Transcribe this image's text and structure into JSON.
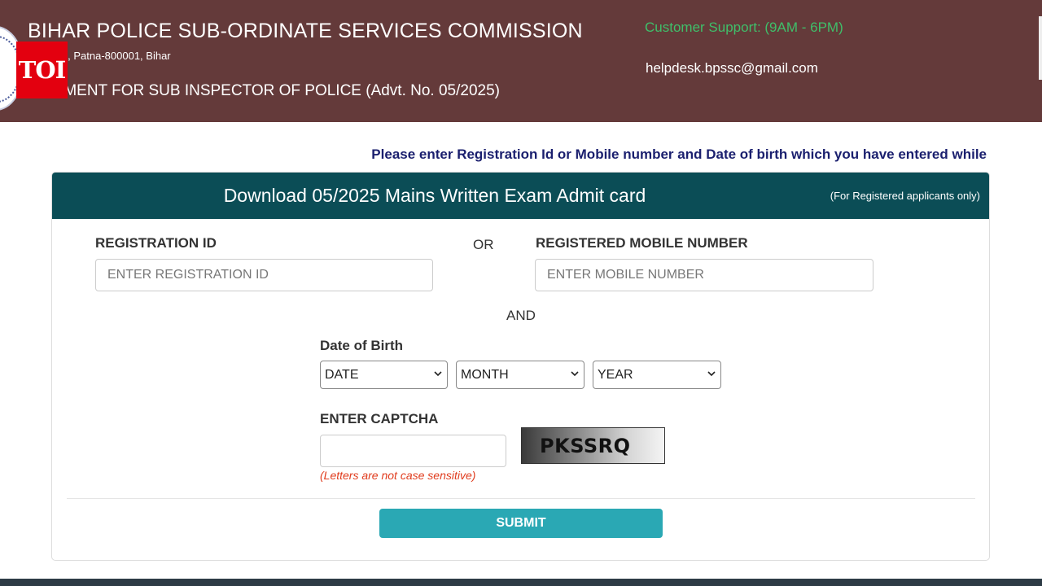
{
  "header": {
    "title": "BIHAR POLICE SUB-ORDINATE SERVICES COMMISSION",
    "address": "ng Road, Patna-800001, Bihar",
    "recruitment": "RUITMENT FOR SUB INSPECTOR OF POLICE (Advt. No. 05/2025)",
    "support": "Customer Support: (9AM - 6PM)",
    "email": "helpdesk.bpssc@gmail.com",
    "overlay_logo": "TOI"
  },
  "notice": "Please enter Registration Id or Mobile number and Date of birth which you have entered while",
  "card": {
    "title": "Download 05/2025 Mains Written Exam Admit card",
    "subtitle": "(For Registered applicants only)"
  },
  "form": {
    "registration_label": "REGISTRATION ID",
    "registration_placeholder": "ENTER REGISTRATION ID",
    "or_text": "OR",
    "mobile_label": "REGISTERED MOBILE NUMBER",
    "mobile_placeholder": "ENTER MOBILE NUMBER",
    "and_text": "AND",
    "dob_label": "Date of Birth",
    "date_select": "DATE",
    "month_select": "MONTH",
    "year_select": "YEAR",
    "captcha_label": "ENTER CAPTCHA",
    "captcha_value": "",
    "captcha_image_text": "PKSSRQ",
    "captcha_hint": "(Letters are not case sensitive)",
    "submit_label": "SUBMIT"
  },
  "colors": {
    "header_bg": "#643a3a",
    "card_header_bg": "#0b4d56",
    "support_text": "#3fbf6a",
    "notice_text": "#1a1f6e",
    "submit_bg": "#2aa8b4",
    "hint_text": "#e03c1e",
    "toi_red": "#e3000f"
  }
}
